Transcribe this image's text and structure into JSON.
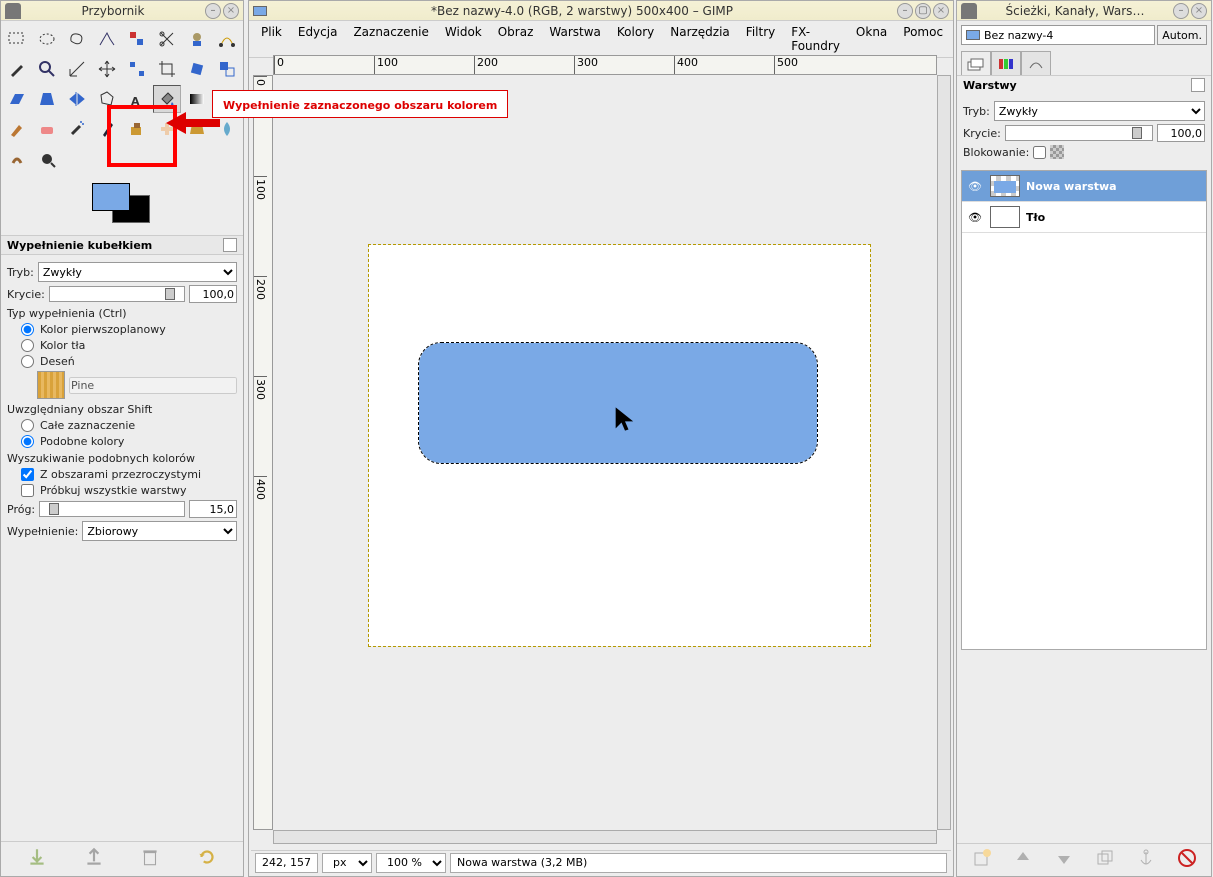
{
  "toolbox": {
    "title": "Przybornik",
    "options_title": "Wypełnienie kubełkiem",
    "mode_label": "Tryb:",
    "mode_value": "Zwykły",
    "opacity_label": "Krycie:",
    "opacity_value": "100,0",
    "fill_type_label": "Typ wypełnienia  (Ctrl)",
    "fill_fg": "Kolor pierwszoplanowy",
    "fill_bg": "Kolor tła",
    "fill_pattern": "Deseń",
    "pattern_name": "Pine",
    "affected_label": "Uwzględniany obszar  Shift",
    "affected_whole": "Całe zaznaczenie",
    "affected_similar": "Podobne kolory",
    "similar_label": "Wyszukiwanie podobnych kolorów",
    "transparent": "Z obszarami przezroczystymi",
    "sample_merged": "Próbkuj wszystkie warstwy",
    "threshold_label": "Próg:",
    "threshold_value": "15,0",
    "fill_by_label": "Wypełnienie:",
    "fill_by_value": "Zbiorowy"
  },
  "main": {
    "title": "*Bez nazwy-4.0 (RGB, 2 warstwy) 500x400 – GIMP",
    "menu": [
      "Plik",
      "Edycja",
      "Zaznaczenie",
      "Widok",
      "Obraz",
      "Warstwa",
      "Kolory",
      "Narzędzia",
      "Filtry",
      "FX-Foundry",
      "Okna",
      "Pomoc"
    ],
    "ruler_ticks_h": [
      "0",
      "100",
      "200",
      "300",
      "400",
      "500"
    ],
    "ruler_ticks_v": [
      "0",
      "100",
      "200",
      "300",
      "400"
    ],
    "coords": "242, 157",
    "unit": "px",
    "zoom": "100 %",
    "status_text": "Nowa warstwa (3,2 MB)"
  },
  "layers": {
    "title": "Ścieżki, Kanały, Wars…",
    "image_name": "Bez nazwy-4",
    "auto": "Autom.",
    "section": "Warstwy",
    "mode_label": "Tryb:",
    "mode_value": "Zwykły",
    "opacity_label": "Krycie:",
    "opacity_value": "100,0",
    "lock_label": "Blokowanie:",
    "layer_items": [
      {
        "name": "Nowa warstwa",
        "selected": true
      },
      {
        "name": "Tło",
        "selected": false
      }
    ]
  },
  "callout": {
    "text": "Wypełnienie zaznaczonego obszaru kolorem"
  },
  "colors": {
    "fg": "#7aa9e6",
    "bg": "#000000"
  }
}
